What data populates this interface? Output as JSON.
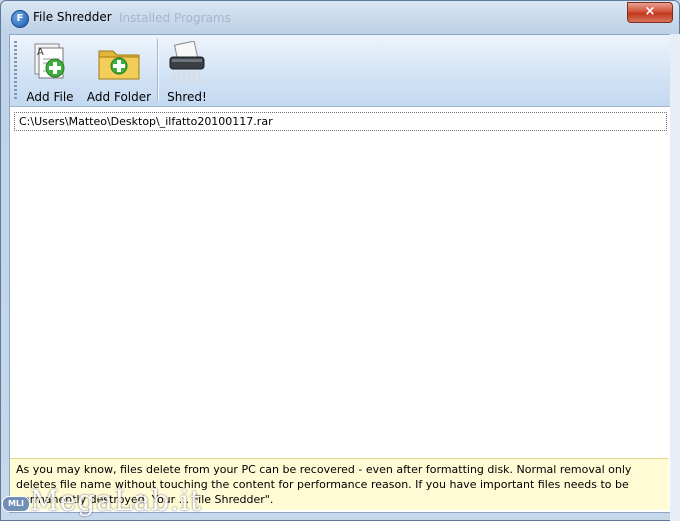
{
  "window": {
    "title": "File Shredder",
    "app_icon": "file-shredder-app-icon",
    "background_ghost_title": "Installed Programs",
    "close_label": "×"
  },
  "toolbar": {
    "add_file_label": "Add File",
    "add_folder_label": "Add Folder",
    "shred_label": "Shred!"
  },
  "files": [
    "C:\\Users\\Matteo\\Desktop\\_ilfatto20100117.rar"
  ],
  "info": {
    "text": "As you may know, files delete from your PC can be recovered - even after formatting disk. Normal removal only deletes file name without touching the content for performance reason. If you have important files needs to be permanently destroyed, Your ... File Shredder\"."
  },
  "watermark": {
    "badge": "MLI",
    "text": "MegaLab.it"
  },
  "colors": {
    "titlebar": "#d9e6f3",
    "toolbar": "#d6e5f6",
    "close": "#c0391e",
    "info_bg": "#fffbd4"
  }
}
